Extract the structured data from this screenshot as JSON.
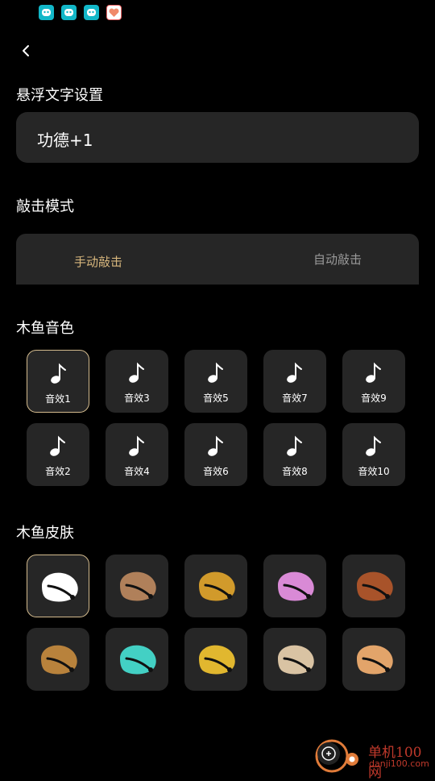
{
  "status_bar": {
    "notifications": [
      "robot-app-icon",
      "robot-app-icon",
      "robot-app-icon",
      "heart-app-icon"
    ]
  },
  "header": {
    "back_icon": "chevron-left-icon"
  },
  "float_text": {
    "title": "悬浮文字设置",
    "value": "功德+1"
  },
  "tap_mode": {
    "title": "敲击模式",
    "tabs": [
      {
        "label": "手动敲击",
        "selected": true
      },
      {
        "label": "自动敲击",
        "selected": false
      }
    ],
    "selected_color": "#d8b77d",
    "unselected_color": "#9a9a9a"
  },
  "sounds": {
    "title": "木鱼音色",
    "items": [
      "音效1",
      "音效3",
      "音效5",
      "音效7",
      "音效9",
      "音效2",
      "音效4",
      "音效6",
      "音效8",
      "音效10"
    ],
    "selected_index": 0
  },
  "skins": {
    "title": "木鱼皮肤",
    "items": [
      {
        "name": "white",
        "color": "#ffffff"
      },
      {
        "name": "wood-light",
        "color": "#b0805a"
      },
      {
        "name": "gold",
        "color": "#d19a2b"
      },
      {
        "name": "pink-purple",
        "color": "#d98ad6"
      },
      {
        "name": "red-wood",
        "color": "#a8532a"
      },
      {
        "name": "bronze",
        "color": "#b8823c"
      },
      {
        "name": "teal",
        "color": "#43d0c4"
      },
      {
        "name": "gold-leaf",
        "color": "#e1b72f"
      },
      {
        "name": "light-wood",
        "color": "#d9c3a3"
      },
      {
        "name": "pale-wood",
        "color": "#e2a46a"
      }
    ],
    "selected_index": 0
  },
  "watermark": {
    "line1": "单机100网",
    "line2": "danji100.com"
  }
}
